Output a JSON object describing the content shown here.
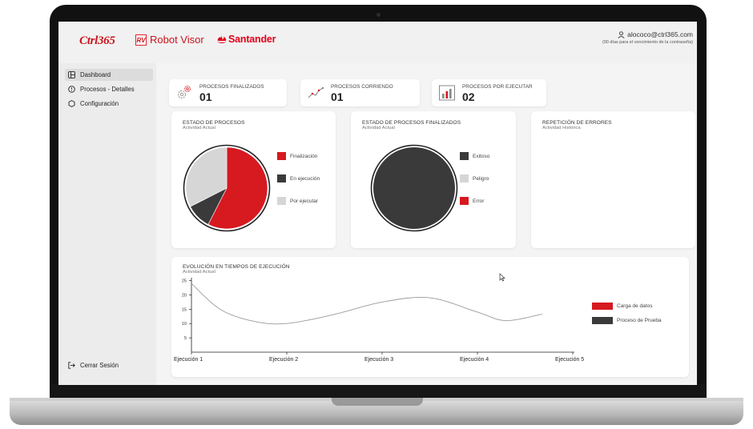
{
  "header": {
    "ctrl_logo": "Ctrl365",
    "rv_badge": "RV",
    "app_name": "Robot Visor",
    "bank_name": "Santander",
    "user_email": "alococo@ctrl365.com",
    "password_notice": "(90 días para el vencimiento de la contraseña)"
  },
  "sidebar": {
    "items": [
      {
        "label": "Dashboard",
        "icon": "dashboard-icon",
        "active": true
      },
      {
        "label": "Procesos - Detalles",
        "icon": "process-details-icon",
        "active": false
      },
      {
        "label": "Configuración",
        "icon": "settings-hexagon-icon",
        "active": false
      }
    ],
    "logout_label": "Cerrar Sesión",
    "logout_icon": "logout-icon"
  },
  "kpis": [
    {
      "label": "PROCESOS FINALIZADOS",
      "value": "01",
      "icon": "gears-icon"
    },
    {
      "label": "PROCESOS CORRIENDO",
      "value": "01",
      "icon": "trend-line-icon"
    },
    {
      "label": "PROCESOS POR EJECUTAR",
      "value": "02",
      "icon": "bar-chart-icon"
    }
  ],
  "colors": {
    "red": "#d71920",
    "dark": "#3a3a3a",
    "light": "#d6d6d6",
    "line": "#9a9a9a"
  },
  "chart_data": [
    {
      "type": "pie",
      "title": "ESTADO DE PROCESOS",
      "subtitle": "Actividad Actual",
      "categories": [
        "Finalización",
        "En ejecución",
        "Por ejecutar"
      ],
      "values": [
        57.5,
        10,
        32.5
      ],
      "colors": [
        "#d71920",
        "#3a3a3a",
        "#d6d6d6"
      ],
      "legend": "right"
    },
    {
      "type": "pie",
      "title": "ESTADO DE PROCESOS FINALIZADOS",
      "subtitle": "Actividad Actual",
      "categories": [
        "Exitoso",
        "Peligro",
        "Error"
      ],
      "values": [
        100,
        0,
        0
      ],
      "colors": [
        "#3a3a3a",
        "#d6d6d6",
        "#d71920"
      ],
      "legend": "right"
    },
    {
      "type": "bar",
      "title": "REPETICIÓN DE ERRORES",
      "subtitle": "Actividad Histórica",
      "values": []
    },
    {
      "type": "line",
      "title": "EVOLUCIÓN EN TIEMPOS DE EJECUCIÓN",
      "subtitle": "Actividad Actual",
      "categories": [
        "Ejecución 1",
        "Ejecución 2",
        "Ejecución 3",
        "Ejecución 4",
        "Ejecución 5"
      ],
      "series": [
        {
          "name": "Proceso de Prueba",
          "x": [
            0.0,
            0.3,
            0.65,
            1.0,
            1.5,
            2.0,
            2.5,
            3.0,
            3.3,
            3.68
          ],
          "values": [
            24,
            15,
            10.8,
            10,
            13.2,
            17.5,
            19,
            14,
            11,
            13.3
          ]
        }
      ],
      "legend_entries": [
        {
          "label": "Carga de datos",
          "color": "#d71920"
        },
        {
          "label": "Proceso de Prueba",
          "color": "#3a3a3a"
        }
      ],
      "yticks": [
        5,
        10,
        15,
        20,
        25
      ],
      "ylim": [
        0,
        26
      ],
      "legend": "right"
    }
  ],
  "cursor": {
    "icon": "mouse-pointer-icon"
  }
}
